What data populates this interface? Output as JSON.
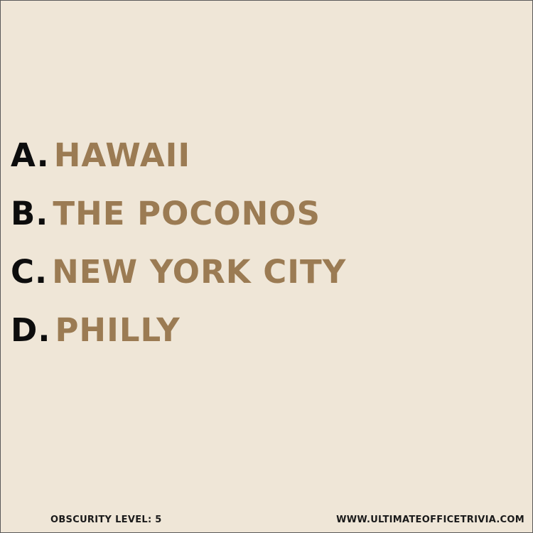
{
  "answers": [
    {
      "letter": "A.",
      "text": "HAWAII"
    },
    {
      "letter": "B.",
      "text": "THE POCONOS"
    },
    {
      "letter": "C.",
      "text": "NEW YORK CITY"
    },
    {
      "letter": "D.",
      "text": "PHILLY"
    }
  ],
  "footer": {
    "obscurity": "OBSCURITY LEVEL: 5",
    "website": "WWW.ULTIMATEOFFICETRIVIA.COM"
  },
  "colors": {
    "background": "#efe6d7",
    "letter": "#0d0d0d",
    "answer_text": "#9b7b53"
  }
}
